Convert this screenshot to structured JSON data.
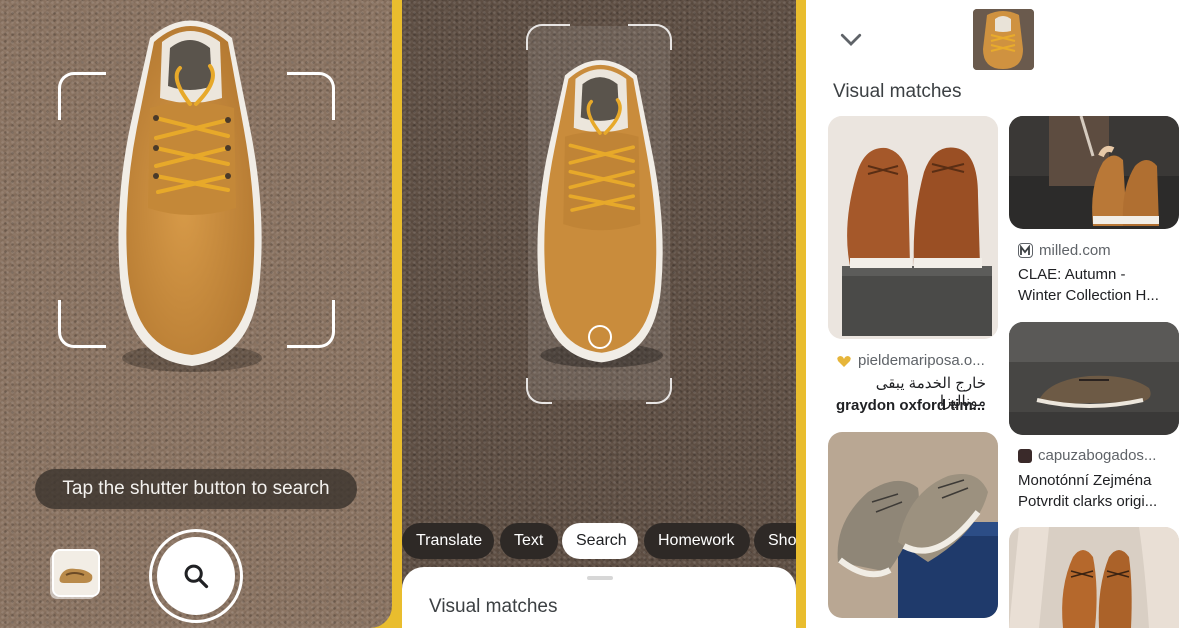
{
  "camera": {
    "hint": "Tap the shutter button to search",
    "icons": {
      "gallery": "gallery-thumbnail-icon",
      "shutter": "search-icon"
    }
  },
  "crop": {
    "tabs": [
      {
        "label": "Translate",
        "active": false
      },
      {
        "label": "Text",
        "active": false
      },
      {
        "label": "Search",
        "active": true
      },
      {
        "label": "Homework",
        "active": false
      },
      {
        "label": "Shop",
        "active": false
      }
    ],
    "sheet_title": "Visual matches"
  },
  "results": {
    "section_title": "Visual matches",
    "icons": {
      "collapse": "chevron-down-icon"
    },
    "cards": [
      {
        "source": "pieldemariposa.o...",
        "subtitle": "خارج الخدمة يبقى مونالیزا",
        "title": "graydon oxford tim..."
      },
      {
        "source": "milled.com",
        "title_line1": "CLAE: Autumn -",
        "title_line2": "Winter Collection H..."
      },
      {
        "source": "capuzabogados...",
        "title_line1": "Monotónní Zejména",
        "title_line2": "Potvrdit clarks origi..."
      }
    ]
  },
  "colors": {
    "divider": "#e9bd2e",
    "chip_dark": "#2e2926",
    "chip_active": "#ffffff",
    "shoe_tan": "#c98c3c",
    "lace": "#e0a52a"
  }
}
